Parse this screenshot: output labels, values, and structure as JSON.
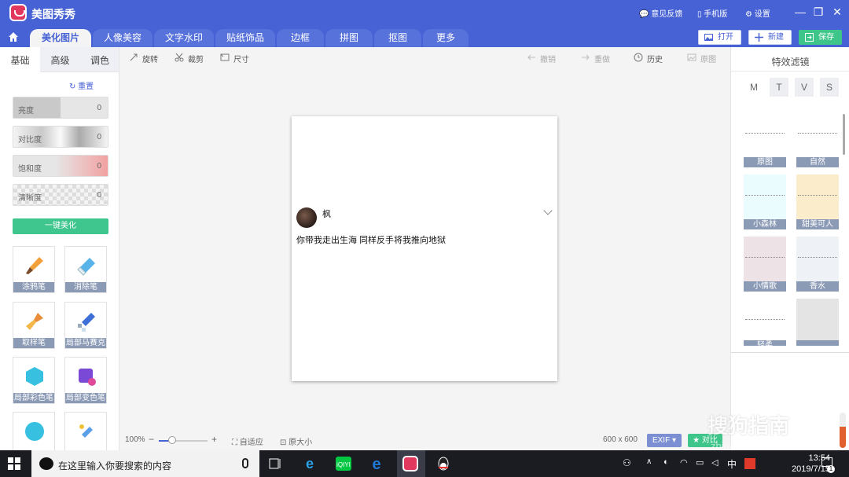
{
  "app": {
    "title": "美图秀秀"
  },
  "titlebar": {
    "feedback": "意见反馈",
    "phone": "手机版",
    "settings": "设置"
  },
  "tabs": [
    "美化图片",
    "人像美容",
    "文字水印",
    "贴纸饰品",
    "边框",
    "拼图",
    "抠图",
    "更多"
  ],
  "actions": {
    "open": "打开",
    "new": "新建",
    "save": "保存"
  },
  "left": {
    "subtabs": [
      "基础",
      "高级",
      "调色"
    ],
    "reset": "重置",
    "sliders": [
      {
        "label": "亮度",
        "value": "0"
      },
      {
        "label": "对比度",
        "value": "0"
      },
      {
        "label": "饱和度",
        "value": "0"
      },
      {
        "label": "清晰度",
        "value": "0"
      }
    ],
    "beautify": "一键美化",
    "tools": [
      "涂鸦笔",
      "消除笔",
      "取样笔",
      "局部马赛克",
      "局部彩色笔",
      "局部变色笔"
    ]
  },
  "canvas": {
    "rotate": "旋转",
    "crop": "裁剪",
    "size": "尺寸",
    "undo": "撤销",
    "redo": "重做",
    "history": "历史",
    "original": "原图",
    "username": "枫",
    "post_text": "你带我走出生海 同样反手将我推向地狱",
    "zoom": "100%",
    "fit": "自适应",
    "actual": "原大小",
    "dimensions": "600 x 600",
    "exif": "EXIF",
    "compare": "对比"
  },
  "right": {
    "title": "特效滤镜",
    "categories": [
      "M",
      "T",
      "V",
      "S"
    ],
    "filters": [
      "原图",
      "自然",
      "小森林",
      "甜美可人",
      "小情歌",
      "香水",
      "轻柔",
      "...."
    ],
    "filter_colors": [
      "#ffffff",
      "#ffffff",
      "#eafcfd",
      "#fbeccb",
      "#ede3e6",
      "#eef2f6",
      "#ffffff",
      "#e4e4e4"
    ]
  },
  "taskbar": {
    "search_placeholder": "在这里输入你要搜索的内容",
    "time": "13:54",
    "date": "2019/7/15",
    "ime": "中",
    "notif_count": "1"
  },
  "watermark": {
    "main": "搜狗指南",
    "sub": "zhinan.sogou.com"
  },
  "colors": {
    "brand": "#4762d4",
    "accent_green": "#3ec68a",
    "label_bg": "#8b9ab5"
  }
}
